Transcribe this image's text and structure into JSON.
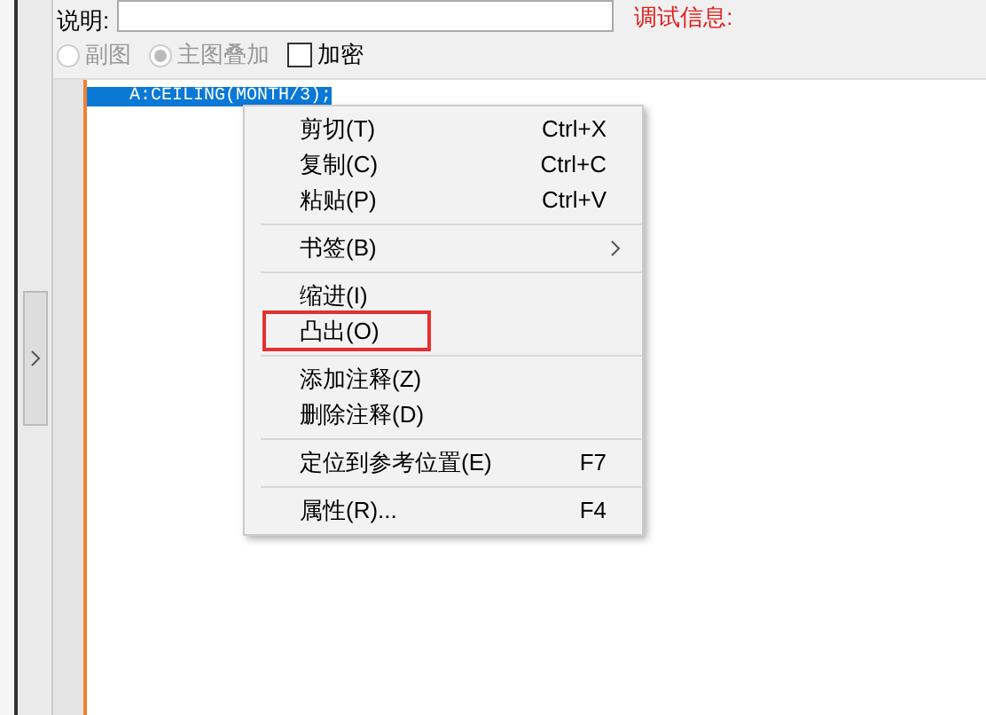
{
  "description": {
    "label": "说明:"
  },
  "debug_label": "调试信息:",
  "options": [
    {
      "kind": "radio",
      "label": "副图",
      "selected": false,
      "disabled": true
    },
    {
      "kind": "radio",
      "label": "主图叠加",
      "selected": true,
      "disabled": true
    },
    {
      "kind": "checkbox",
      "label": "加密",
      "checked": false,
      "disabled": false
    }
  ],
  "editor": {
    "lines": [
      {
        "text": "    A:CEILING(MONTH/3);",
        "selected": true
      }
    ]
  },
  "context_menu": {
    "groups": [
      [
        {
          "label": "剪切(T)",
          "shortcut": "Ctrl+X",
          "submenu": false,
          "highlighted": false
        },
        {
          "label": "复制(C)",
          "shortcut": "Ctrl+C",
          "submenu": false,
          "highlighted": false
        },
        {
          "label": "粘贴(P)",
          "shortcut": "Ctrl+V",
          "submenu": false,
          "highlighted": false
        }
      ],
      [
        {
          "label": "书签(B)",
          "submenu": true,
          "highlighted": false
        }
      ],
      [
        {
          "label": "缩进(I)",
          "submenu": false,
          "highlighted": false
        },
        {
          "label": "凸出(O)",
          "submenu": false,
          "highlighted": true
        }
      ],
      [
        {
          "label": "添加注释(Z)",
          "submenu": false,
          "highlighted": false
        },
        {
          "label": "删除注释(D)",
          "submenu": false,
          "highlighted": false
        }
      ],
      [
        {
          "label": "定位到参考位置(E)",
          "shortcut": "F7",
          "submenu": false,
          "highlighted": false
        }
      ],
      [
        {
          "label": "属性(R)...",
          "shortcut": "F4",
          "submenu": false,
          "highlighted": false
        }
      ]
    ]
  }
}
